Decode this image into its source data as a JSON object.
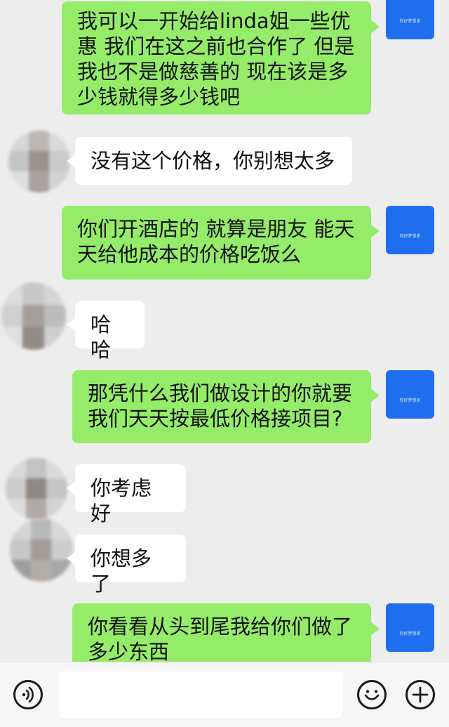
{
  "messages": [
    {
      "side": "out",
      "text": "我可以一开始给linda姐一些优\n惠 我们在这之前也合作了 但是\n我也不是做慈善的 现在该是多\n少钱就得多少钱吧"
    },
    {
      "side": "in",
      "text": "没有这个价格，你别想太多"
    },
    {
      "side": "out",
      "text": "你们开酒店的 就算是朋友 能天\n天给他成本的价格吃饭么"
    },
    {
      "side": "in",
      "text": "哈哈"
    },
    {
      "side": "out",
      "text": "那凭什么我们做设计的你就要\n我们天天按最低价格接项目?"
    },
    {
      "side": "in",
      "text": "你考虑好"
    },
    {
      "side": "in",
      "text": "你想多了"
    },
    {
      "side": "out",
      "text": "你看看从头到尾我给你们做了\n多少东西"
    }
  ],
  "self_avatar_caption": "你好梦想家",
  "colors": {
    "background": "#ededed",
    "outgoing_bubble": "#95ec69",
    "incoming_bubble": "#ffffff",
    "self_avatar": "#1f6ef0"
  },
  "input_bar": {
    "left_icon": "voice-icon",
    "right_icons": [
      "emoji-icon",
      "plus-icon"
    ]
  }
}
